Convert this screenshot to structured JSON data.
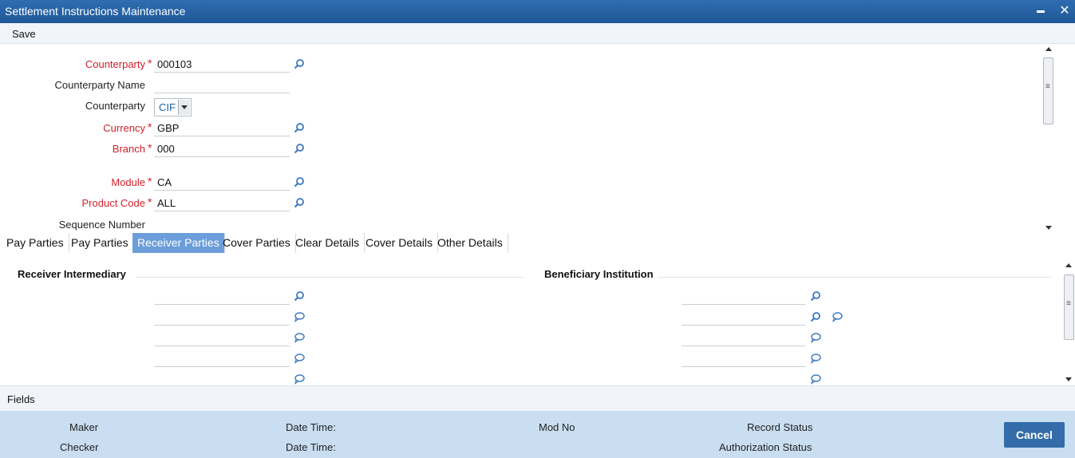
{
  "window": {
    "title": "Settlement Instructions Maintenance"
  },
  "toolbar": {
    "save_label": "Save"
  },
  "header_form": {
    "counterparty": {
      "label": "Counterparty",
      "required": "*",
      "value": "000103"
    },
    "counterparty_name": {
      "label": "Counterparty Name",
      "value": ""
    },
    "counterparty_type": {
      "label": "Counterparty",
      "value": "CIF"
    },
    "currency": {
      "label": "Currency",
      "required": "*",
      "value": "GBP"
    },
    "branch": {
      "label": "Branch",
      "required": "*",
      "value": "000"
    },
    "module": {
      "label": "Module",
      "required": "*",
      "value": "CA"
    },
    "product_code": {
      "label": "Product Code",
      "required": "*",
      "value": "ALL"
    },
    "sequence_number": {
      "label": "Sequence Number"
    }
  },
  "tabs": [
    {
      "label": "Pay Parties"
    },
    {
      "label": "Pay Parties"
    },
    {
      "label": "Receiver Parties",
      "active": true
    },
    {
      "label": "Cover Parties"
    },
    {
      "label": "Clear Details"
    },
    {
      "label": "Cover Details"
    },
    {
      "label": "Other Details"
    }
  ],
  "receiver_parties": {
    "receiver_intermediary": {
      "title": "Receiver Intermediary"
    },
    "beneficiary_institution": {
      "title": "Beneficiary Institution"
    }
  },
  "fields_bar": {
    "label": "Fields"
  },
  "footer": {
    "maker": "Maker",
    "checker": "Checker",
    "date_time_1": "Date Time:",
    "date_time_2": "Date Time:",
    "mod_no": "Mod No",
    "record_status": "Record Status",
    "authorization_status": "Authorization Status",
    "cancel_label": "Cancel"
  },
  "colors": {
    "title_bar": "#1e5797",
    "required_label": "#d0202a",
    "active_tab": "#6c9edb",
    "footer_bg": "#c9def0",
    "cancel_button": "#336ca8"
  },
  "icons": {
    "lookup": "search-icon",
    "memo": "speech-bubble-icon"
  }
}
